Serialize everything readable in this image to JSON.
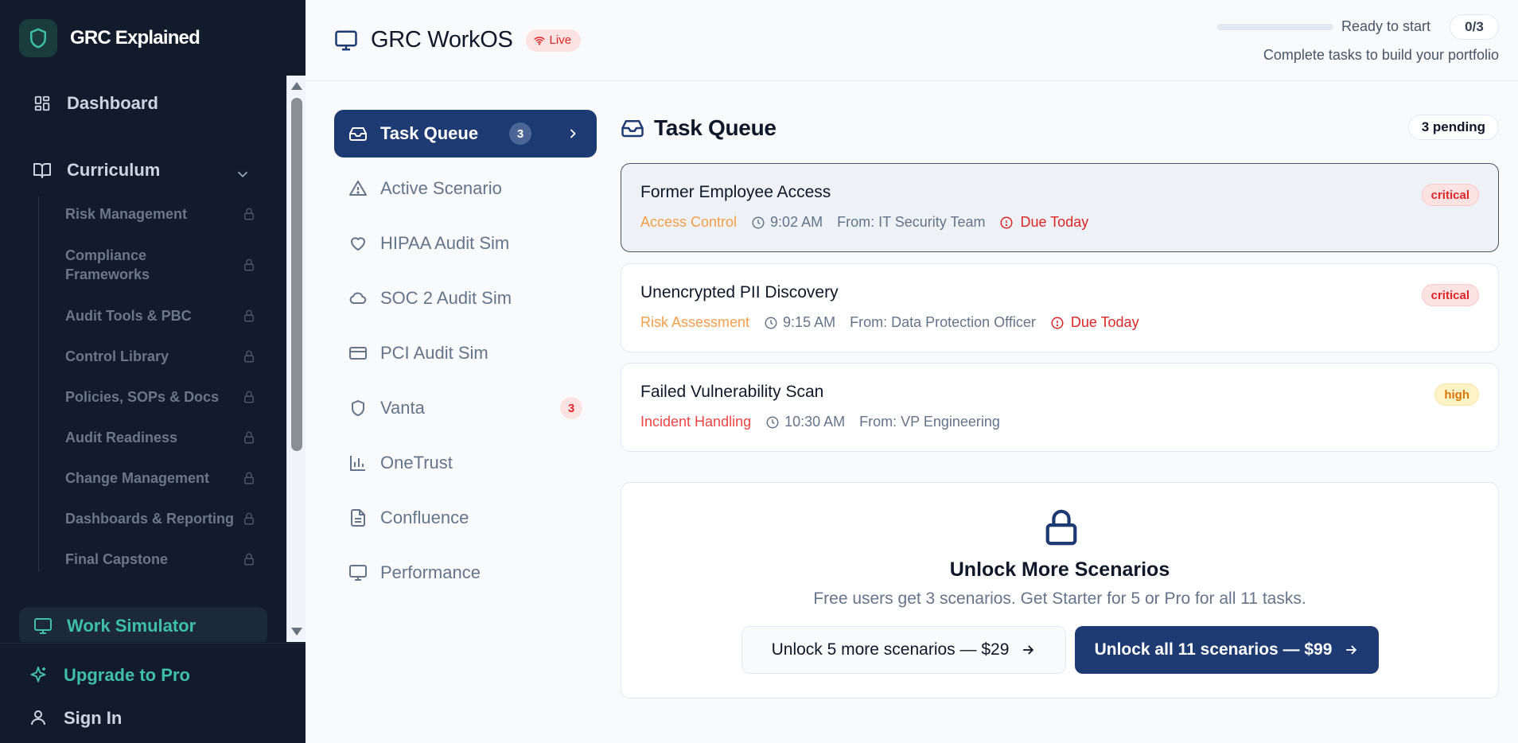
{
  "brand": {
    "name": "GRC Explained"
  },
  "sidebar": {
    "dashboard_label": "Dashboard",
    "curriculum_label": "Curriculum",
    "curriculum_items": [
      {
        "label": "Risk Management"
      },
      {
        "label": "Compliance Frameworks"
      },
      {
        "label": "Audit Tools & PBC"
      },
      {
        "label": "Control Library"
      },
      {
        "label": "Policies, SOPs & Docs"
      },
      {
        "label": "Audit Readiness"
      },
      {
        "label": "Change Management"
      },
      {
        "label": "Dashboards & Reporting"
      },
      {
        "label": "Final Capstone"
      }
    ],
    "work_simulator_label": "Work Simulator",
    "upgrade_label": "Upgrade to Pro",
    "sign_in_label": "Sign In"
  },
  "header": {
    "title": "GRC WorkOS",
    "live_badge": "Live",
    "progress_fraction": 0.0,
    "status_text": "Ready to start",
    "count": "0/3",
    "subtitle": "Complete tasks to build your portfolio"
  },
  "modules": [
    {
      "label": "Task Queue",
      "badge": "3",
      "icon": "inbox-icon",
      "active": true
    },
    {
      "label": "Active Scenario",
      "icon": "alert-triangle-icon"
    },
    {
      "label": "HIPAA Audit Sim",
      "icon": "heart-icon"
    },
    {
      "label": "SOC 2 Audit Sim",
      "icon": "cloud-icon"
    },
    {
      "label": "PCI Audit Sim",
      "icon": "credit-card-icon"
    },
    {
      "label": "Vanta",
      "badge": "3",
      "icon": "shield-icon"
    },
    {
      "label": "OneTrust",
      "icon": "bar-chart-icon"
    },
    {
      "label": "Confluence",
      "icon": "file-text-icon"
    },
    {
      "label": "Performance",
      "icon": "monitor-icon"
    }
  ],
  "main": {
    "title": "Task Queue",
    "pending": "3 pending",
    "tasks": [
      {
        "title": "Former Employee Access",
        "category": "Access Control",
        "category_color": "#f59e4b",
        "time": "9:02 AM",
        "from": "From: IT Security Team",
        "due": "Due Today",
        "priority": "critical"
      },
      {
        "title": "Unencrypted PII Discovery",
        "category": "Risk Assessment",
        "category_color": "#f59e4b",
        "time": "9:15 AM",
        "from": "From: Data Protection Officer",
        "due": "Due Today",
        "priority": "critical"
      },
      {
        "title": "Failed Vulnerability Scan",
        "category": "Incident Handling",
        "category_color": "#ef4444",
        "time": "10:30 AM",
        "from": "From: VP Engineering",
        "due": "",
        "priority": "high"
      }
    ],
    "unlock": {
      "title": "Unlock More Scenarios",
      "subtitle": "Free users get 3 scenarios. Get Starter for 5 or Pro for all 11 tasks.",
      "starter_button": "Unlock 5 more scenarios — $29",
      "pro_button": "Unlock all 11 scenarios — $99"
    }
  },
  "colors": {
    "sidebar_bg": "#111b2b",
    "accent_teal": "#3fbfa8",
    "primary_navy": "#1e3a73",
    "critical": "#dc2626",
    "high": "#d97706"
  }
}
